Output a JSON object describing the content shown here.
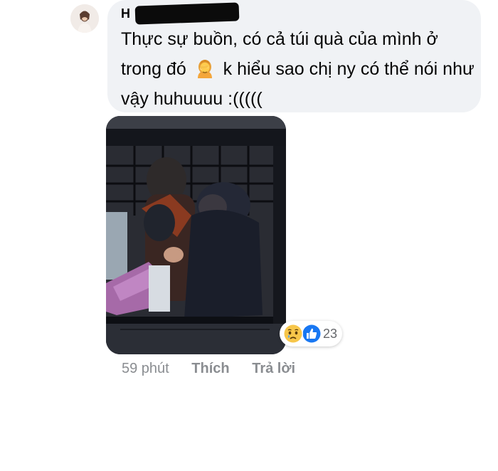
{
  "comment": {
    "author": "H",
    "text_part1": "Thực sự buồn, có cả túi quà của mình ở trong đó",
    "text_part2": "k hiểu sao chị ny có thể nói như vậy huhuuuu :(((((",
    "inline_emoji": "woman-facepalming-icon",
    "photo": "photo-people-behind-window",
    "reactions": {
      "icons": [
        "sad-reaction-icon",
        "like-reaction-icon"
      ],
      "count": "23"
    },
    "actions": {
      "time": "59 phút",
      "like": "Thích",
      "reply": "Trả lời"
    }
  },
  "colors": {
    "bubble": "#f0f2f5",
    "like_blue": "#1877f2",
    "sad_yellow": "#f7c64a",
    "muted_text": "#8a8d91"
  }
}
